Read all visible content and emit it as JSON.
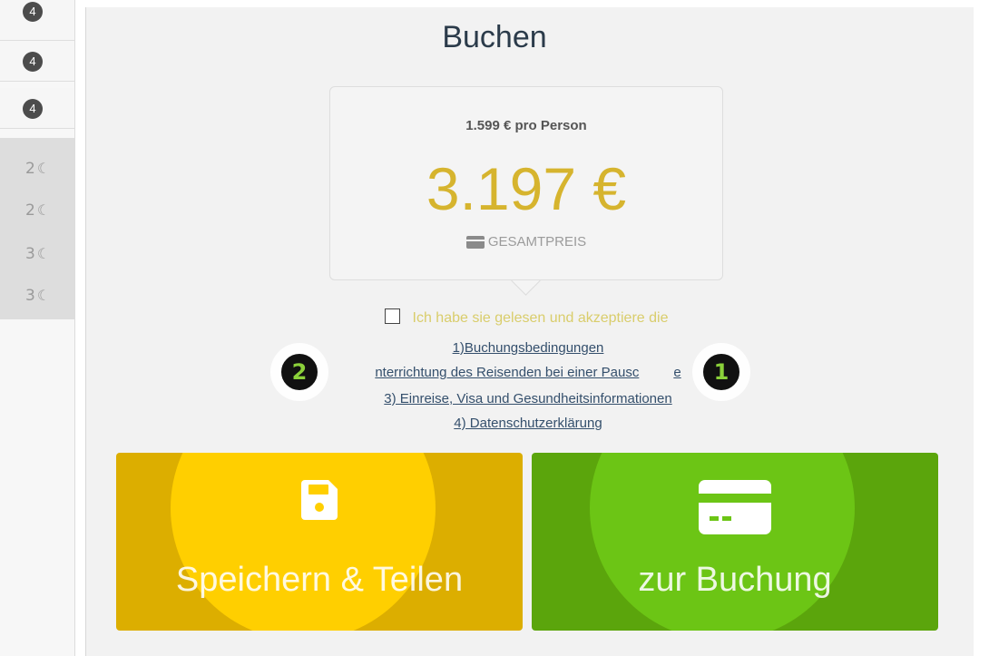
{
  "sidebar": {
    "badges": [
      "4",
      "4",
      "4"
    ],
    "nights": [
      {
        "count": "2",
        "icon": "moon-icon"
      },
      {
        "count": "2",
        "icon": "moon-icon"
      },
      {
        "count": "3",
        "icon": "moon-icon"
      },
      {
        "count": "3",
        "icon": "moon-icon"
      }
    ]
  },
  "booking": {
    "title": "Buchen",
    "price_per_person": "1.599 € pro Person",
    "total_price": "3.197 €",
    "total_label": "GESAMTPREIS",
    "consent_text": "Ich habe sie gelesen und akzeptiere die",
    "links": [
      "1)Buchungsbedingungen",
      "nterrichtung des Reisenden bei einer Pausc",
      "3) Einreise, Visa und Gesundheitsinformationen",
      "4) Datenschutzerklärung"
    ],
    "link2_tail": "e",
    "save_button": "Speichern & Teilen",
    "book_button": "zur Buchung"
  },
  "markers": [
    "2",
    "1"
  ],
  "colors": {
    "save": "#dcae00",
    "book": "#5ba50c",
    "price": "#d6b42e",
    "link": "#344f6c",
    "marker_number": "#8bd13a"
  }
}
